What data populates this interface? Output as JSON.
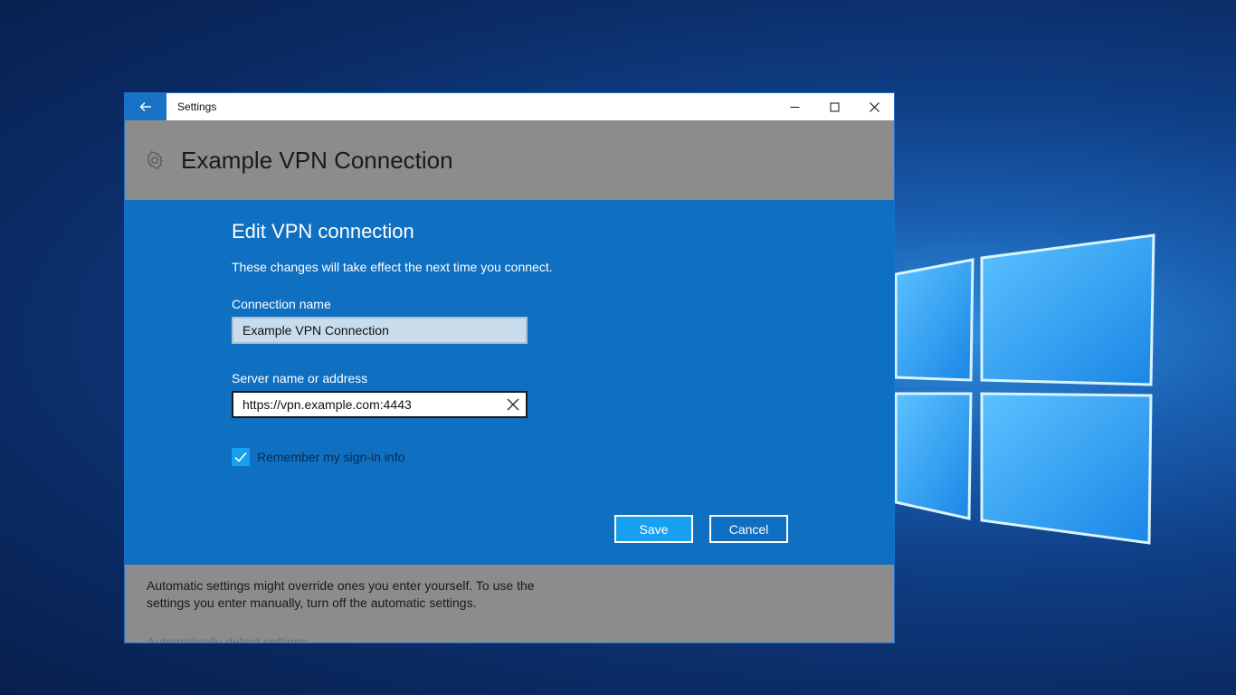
{
  "window": {
    "app_title": "Settings",
    "controls": {
      "minimize": "minimize-icon",
      "maximize": "maximize-icon",
      "close": "close-icon"
    }
  },
  "header": {
    "icon": "gear-icon",
    "title": "Example VPN Connection"
  },
  "dialog": {
    "title": "Edit VPN connection",
    "description": "These changes will take effect the next time you connect.",
    "connection_name": {
      "label": "Connection name",
      "value": "Example VPN Connection"
    },
    "server": {
      "label": "Server name or address",
      "value": "https://vpn.example.com:4443"
    },
    "remember": {
      "label": "Remember my sign-in info",
      "checked": true
    },
    "save_label": "Save",
    "cancel_label": "Cancel"
  },
  "footer": {
    "note": "Automatic settings might override ones you enter yourself. To use the settings you enter manually, turn off the automatic settings.",
    "partial_heading": "Automatically detect settings"
  },
  "colors": {
    "accent": "#0f6fc1",
    "title_back": "#1873c7",
    "save_button": "#18a0f0",
    "checkbox": "#17a0ee",
    "overlay_gray": "#8c8c8c"
  }
}
